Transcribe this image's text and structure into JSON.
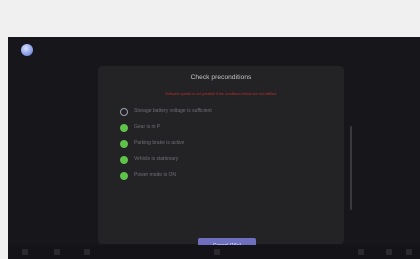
{
  "dialog": {
    "title": "Check preconditions",
    "warning": "Software update is not possible if the conditions below are not fulfilled.",
    "cancel_label": "Cancel (15s)"
  },
  "preconditions": [
    {
      "label": "Storage battery voltage is sufficient",
      "status": "pending"
    },
    {
      "label": "Gear is in P",
      "status": "ok"
    },
    {
      "label": "Parking brake is active",
      "status": "ok"
    },
    {
      "label": "Vehicle is stationary",
      "status": "ok"
    },
    {
      "label": "Power mode is ON",
      "status": "ok"
    }
  ],
  "colors": {
    "ok": "#5fc24a",
    "warning": "#b8302a",
    "button": "#6e6fbf"
  }
}
